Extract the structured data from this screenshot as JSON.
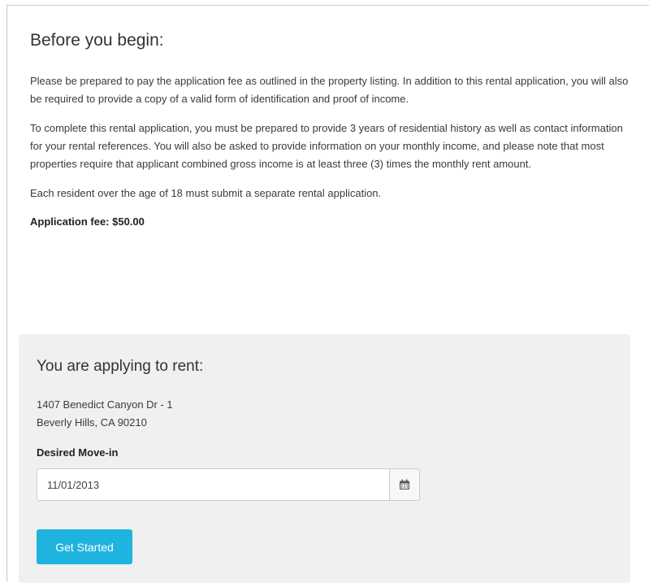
{
  "intro": {
    "title": "Before you begin:",
    "paragraphs": [
      "Please be prepared to pay the application fee as outlined in the property listing. In addition to this rental application, you will also be required to provide a copy of a valid form of identification and proof of income.",
      "To complete this rental application, you must be prepared to provide 3 years of residential history as well as contact information for your rental references. You will also be asked to provide information on your monthly income, and please note that most properties require that applicant combined gross income is at least three (3) times the monthly rent amount.",
      "Each resident over the age of 18 must submit a separate rental application."
    ],
    "fee": "Application fee: $50.00"
  },
  "rent": {
    "title": "You are applying to rent:",
    "address_line1": "1407 Benedict Canyon Dr - 1",
    "address_line2": "Beverly Hills, CA 90210",
    "move_in_label": "Desired Move-in",
    "move_in_value": "11/01/2013",
    "calendar_icon": "calendar-icon",
    "button_label": "Get Started"
  },
  "colors": {
    "accent": "#1fb3df",
    "panel_bg": "#f0f0f0"
  }
}
